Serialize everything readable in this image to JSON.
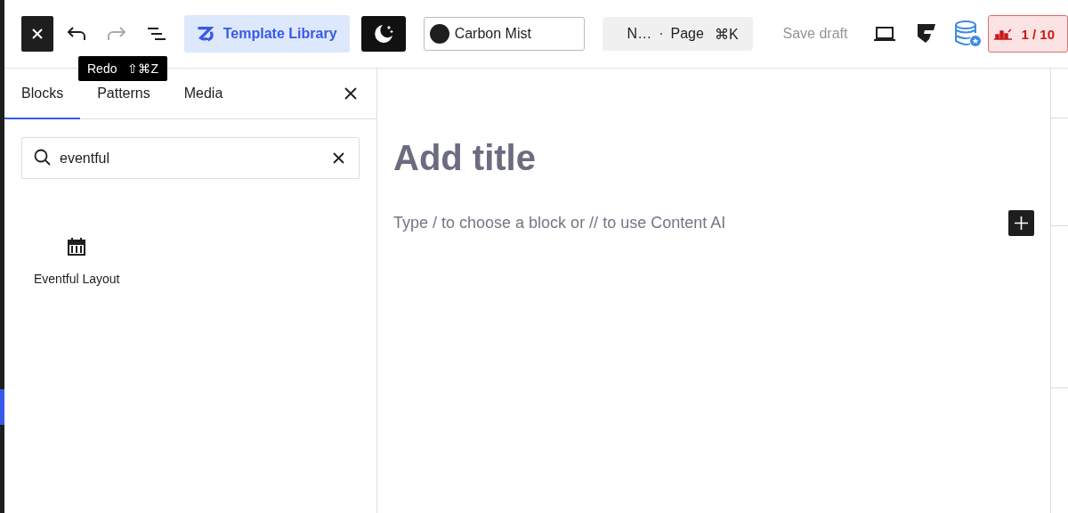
{
  "toolbar": {
    "buttons": [
      {
        "kind": "close",
        "disabled": false
      },
      {
        "kind": "undo",
        "disabled": false
      },
      {
        "kind": "redo",
        "disabled": true
      },
      {
        "kind": "list",
        "disabled": false
      }
    ],
    "template_library": {
      "label": "Template Library"
    },
    "theme_select": {
      "value": "Carbon Mist",
      "color": "#1e1e1e"
    },
    "command_bar": {
      "title": "N…",
      "separator": "·",
      "type": "Page",
      "shortcut": "⌘K"
    },
    "save_draft": {
      "label": "Save draft"
    },
    "badge": {
      "text": "1 / 10"
    }
  },
  "tooltip": {
    "label": "Redo",
    "shortcut": "⇧⌘Z"
  },
  "sidebar": {
    "tabs": [
      {
        "label": "Blocks",
        "selected": true
      },
      {
        "label": "Patterns",
        "selected": false
      },
      {
        "label": "Media",
        "selected": false
      }
    ],
    "search": {
      "value": "eventful"
    },
    "results": [
      {
        "label": "Eventful Layout"
      }
    ]
  },
  "editor": {
    "title_placeholder": "Add title",
    "paragraph_placeholder": "Type / to choose a block or // to use Content AI"
  }
}
